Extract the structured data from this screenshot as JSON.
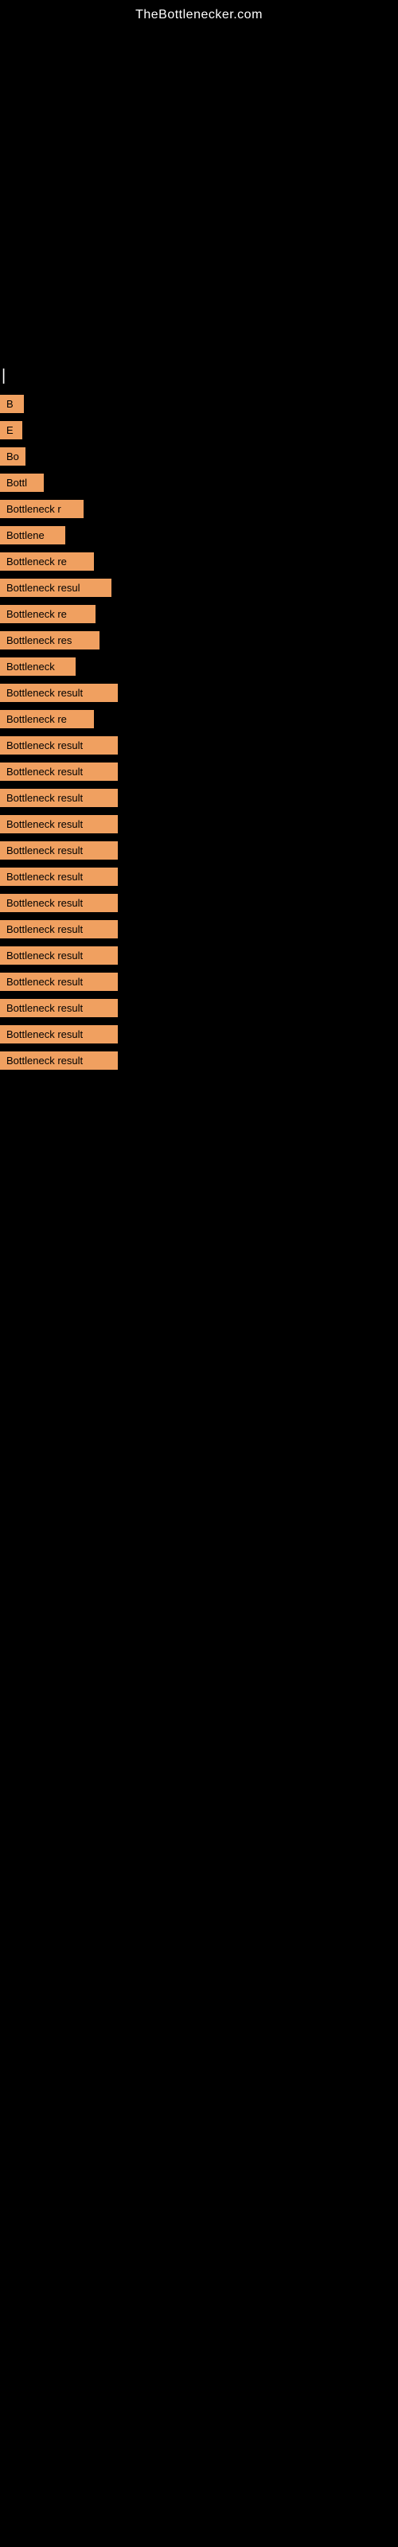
{
  "header": {
    "site_title": "TheBottlenecker.com"
  },
  "results": [
    {
      "id": 1,
      "label": "B",
      "width": 30
    },
    {
      "id": 2,
      "label": "E",
      "width": 28
    },
    {
      "id": 3,
      "label": "Bo",
      "width": 32
    },
    {
      "id": 4,
      "label": "Bottl",
      "width": 55
    },
    {
      "id": 5,
      "label": "Bottleneck r",
      "width": 105
    },
    {
      "id": 6,
      "label": "Bottlene",
      "width": 82
    },
    {
      "id": 7,
      "label": "Bottleneck re",
      "width": 118
    },
    {
      "id": 8,
      "label": "Bottleneck resul",
      "width": 140
    },
    {
      "id": 9,
      "label": "Bottleneck re",
      "width": 120
    },
    {
      "id": 10,
      "label": "Bottleneck res",
      "width": 125
    },
    {
      "id": 11,
      "label": "Bottleneck",
      "width": 95
    },
    {
      "id": 12,
      "label": "Bottleneck result",
      "width": 148
    },
    {
      "id": 13,
      "label": "Bottleneck re",
      "width": 118
    },
    {
      "id": 14,
      "label": "Bottleneck result",
      "width": 148
    },
    {
      "id": 15,
      "label": "Bottleneck result",
      "width": 148
    },
    {
      "id": 16,
      "label": "Bottleneck result",
      "width": 148
    },
    {
      "id": 17,
      "label": "Bottleneck result",
      "width": 148
    },
    {
      "id": 18,
      "label": "Bottleneck result",
      "width": 148
    },
    {
      "id": 19,
      "label": "Bottleneck result",
      "width": 148
    },
    {
      "id": 20,
      "label": "Bottleneck result",
      "width": 148
    },
    {
      "id": 21,
      "label": "Bottleneck result",
      "width": 148
    },
    {
      "id": 22,
      "label": "Bottleneck result",
      "width": 148
    },
    {
      "id": 23,
      "label": "Bottleneck result",
      "width": 148
    },
    {
      "id": 24,
      "label": "Bottleneck result",
      "width": 148
    },
    {
      "id": 25,
      "label": "Bottleneck result",
      "width": 148
    },
    {
      "id": 26,
      "label": "Bottleneck result",
      "width": 148
    }
  ]
}
